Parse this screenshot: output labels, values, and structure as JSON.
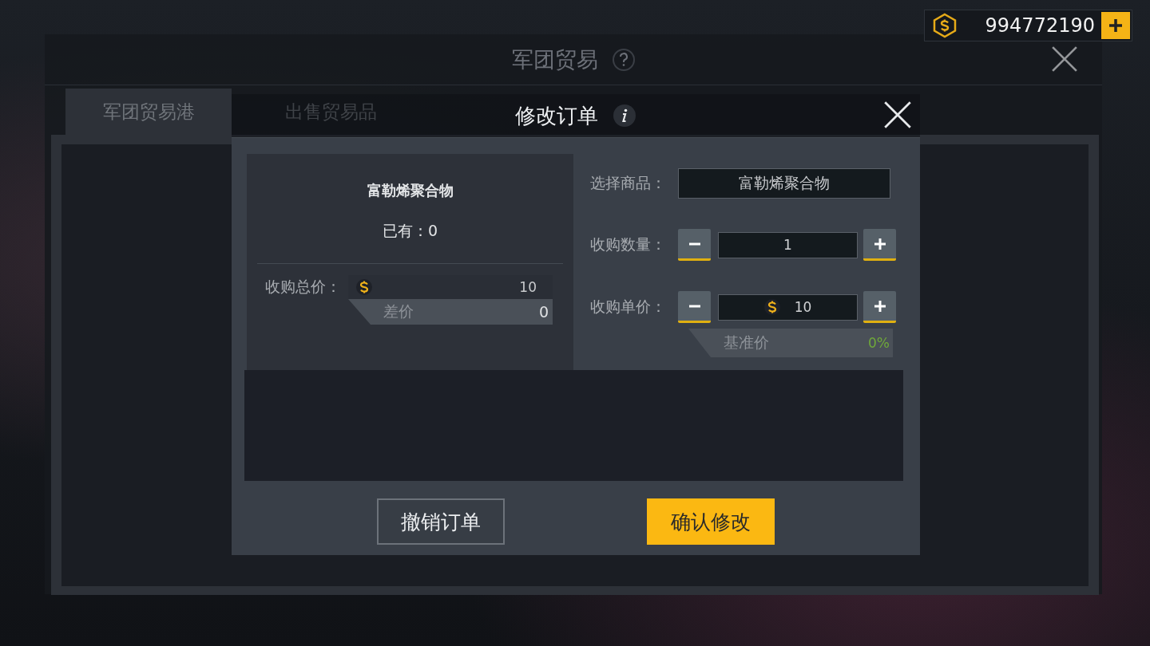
{
  "currency": {
    "amount": "994772190"
  },
  "trade_window": {
    "title": "军团贸易",
    "tabs": [
      {
        "label": "军团贸易港",
        "selected": true
      },
      {
        "label": "出售贸易品",
        "selected": false
      }
    ]
  },
  "dialog": {
    "title": "修改订单",
    "item": {
      "name": "富勒烯聚合物",
      "owned": "已有：0"
    },
    "total": {
      "label": "收购总价：",
      "value": "10",
      "diff_label": "差价",
      "diff_value": "0"
    },
    "select": {
      "label": "选择商品：",
      "value": "富勒烯聚合物"
    },
    "quantity": {
      "label": "收购数量：",
      "value": "1"
    },
    "unit_price": {
      "label": "收购单价：",
      "value": "10",
      "base_label": "基准价",
      "base_value": "0%"
    },
    "buttons": [
      {
        "label": "撤销订单",
        "kind": "secondary"
      },
      {
        "label": "确认修改",
        "kind": "primary"
      }
    ]
  }
}
